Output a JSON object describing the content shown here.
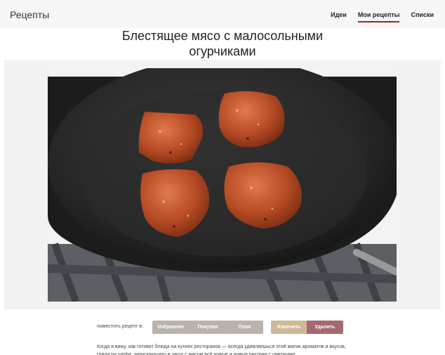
{
  "header": {
    "brand": "Рецепты",
    "nav": [
      {
        "label": "Идеи",
        "active": false
      },
      {
        "label": "Мои рецепты",
        "active": true
      },
      {
        "label": "Списки",
        "active": false
      }
    ],
    "accent_color": "#8f2a2a"
  },
  "recipe": {
    "title_line1": "Блестящее мясо с малосольными",
    "title_line2": "огурчиками",
    "image_subject": "pork pieces searing in a wok"
  },
  "actions": {
    "label": "поместить рецепт в:",
    "segments": [
      "Избранное",
      "Покупки",
      "План"
    ],
    "edit_label": "Изменить",
    "delete_label": "Удалить"
  },
  "description": "Когда я вижу, как готовят блюда на кухнях ресторанов — всегда удивляешься этой магии ароматов и вкусов, глядя на шефа, запускающего в чашу с мясом всё новые и новые нисочки с цветными"
}
